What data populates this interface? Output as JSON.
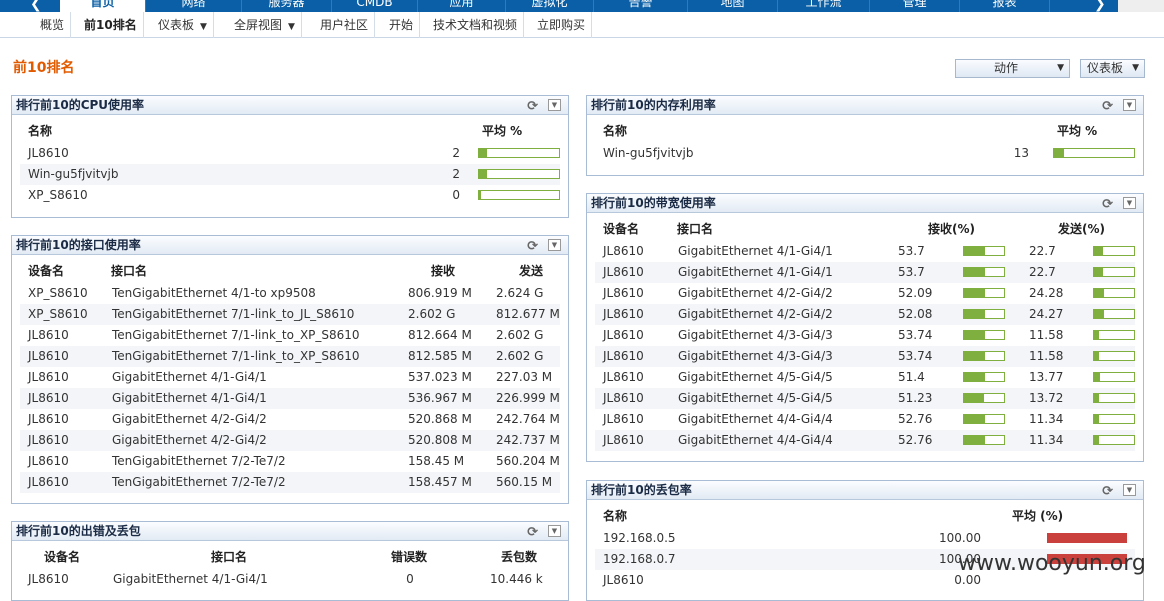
{
  "top_nav": {
    "tabs": [
      "首页",
      "网络",
      "服务器",
      "CMDB",
      "应用",
      "虚拟化",
      "告警",
      "地图",
      "工作流",
      "管理",
      "报表"
    ],
    "active": 0
  },
  "sub_nav": {
    "items": [
      {
        "label": "概览",
        "dropdown": false
      },
      {
        "label": "前10排名",
        "dropdown": false
      },
      {
        "label": "仪表板",
        "dropdown": true
      },
      {
        "label": "全屏视图",
        "dropdown": true
      },
      {
        "label": "用户社区",
        "dropdown": false
      },
      {
        "label": "开始",
        "dropdown": false
      },
      {
        "label": "技术文档和视频",
        "dropdown": false
      },
      {
        "label": "立即购买",
        "dropdown": false
      }
    ],
    "active": 1
  },
  "page_title": "前10排名",
  "actions": {
    "action_select": "动作",
    "dashboard_select": "仪表板"
  },
  "cpu": {
    "title": "排行前10的CPU使用率",
    "headers": [
      "名称",
      "平均 %"
    ],
    "rows": [
      {
        "name": "JL8610",
        "value": "2",
        "pct": 2
      },
      {
        "name": "Win-gu5fjvitvjb",
        "value": "2",
        "pct": 2
      },
      {
        "name": "XP_S8610",
        "value": "0",
        "pct": 0
      }
    ]
  },
  "memory": {
    "title": "排行前10的内存利用率",
    "headers": [
      "名称",
      "平均 %"
    ],
    "rows": [
      {
        "name": "Win-gu5fjvitvjb",
        "value": "13",
        "pct": 13
      }
    ]
  },
  "interface": {
    "title": "排行前10的接口使用率",
    "headers": [
      "设备名",
      "接口名",
      "接收",
      "发送"
    ],
    "rows": [
      [
        "XP_S8610",
        "TenGigabitEthernet 4/1-to xp9508",
        "806.919 M",
        "2.624 G"
      ],
      [
        "XP_S8610",
        "TenGigabitEthernet 7/1-link_to_JL_S8610",
        "2.602 G",
        "812.677 M"
      ],
      [
        "JL8610",
        "TenGigabitEthernet 7/1-link_to_XP_S8610",
        "812.664 M",
        "2.602 G"
      ],
      [
        "JL8610",
        "TenGigabitEthernet 7/1-link_to_XP_S8610",
        "812.585 M",
        "2.602 G"
      ],
      [
        "JL8610",
        "GigabitEthernet 4/1-Gi4/1",
        "537.023 M",
        "227.03 M"
      ],
      [
        "JL8610",
        "GigabitEthernet 4/1-Gi4/1",
        "536.967 M",
        "226.999 M"
      ],
      [
        "JL8610",
        "GigabitEthernet 4/2-Gi4/2",
        "520.868 M",
        "242.764 M"
      ],
      [
        "JL8610",
        "GigabitEthernet 4/2-Gi4/2",
        "520.808 M",
        "242.737 M"
      ],
      [
        "JL8610",
        "TenGigabitEthernet 7/2-Te7/2",
        "158.45 M",
        "560.204 M"
      ],
      [
        "JL8610",
        "TenGigabitEthernet 7/2-Te7/2",
        "158.457 M",
        "560.15 M"
      ]
    ]
  },
  "bandwidth": {
    "title": "排行前10的带宽使用率",
    "headers": [
      "设备名",
      "接口名",
      "接收(%)",
      "发送(%)"
    ],
    "rows": [
      {
        "device": "JL8610",
        "iface": "GigabitEthernet 4/1-Gi4/1",
        "rx": "53.7",
        "tx": "22.7"
      },
      {
        "device": "JL8610",
        "iface": "GigabitEthernet 4/1-Gi4/1",
        "rx": "53.7",
        "tx": "22.7"
      },
      {
        "device": "JL8610",
        "iface": "GigabitEthernet 4/2-Gi4/2",
        "rx": "52.09",
        "tx": "24.28"
      },
      {
        "device": "JL8610",
        "iface": "GigabitEthernet 4/2-Gi4/2",
        "rx": "52.08",
        "tx": "24.27"
      },
      {
        "device": "JL8610",
        "iface": "GigabitEthernet 4/3-Gi4/3",
        "rx": "53.74",
        "tx": "11.58"
      },
      {
        "device": "JL8610",
        "iface": "GigabitEthernet 4/3-Gi4/3",
        "rx": "53.74",
        "tx": "11.58"
      },
      {
        "device": "JL8610",
        "iface": "GigabitEthernet 4/5-Gi4/5",
        "rx": "51.4",
        "tx": "13.77"
      },
      {
        "device": "JL8610",
        "iface": "GigabitEthernet 4/5-Gi4/5",
        "rx": "51.23",
        "tx": "13.72"
      },
      {
        "device": "JL8610",
        "iface": "GigabitEthernet 4/4-Gi4/4",
        "rx": "52.76",
        "tx": "11.34"
      },
      {
        "device": "JL8610",
        "iface": "GigabitEthernet 4/4-Gi4/4",
        "rx": "52.76",
        "tx": "11.34"
      }
    ]
  },
  "errors": {
    "title": "排行前10的出错及丢包",
    "headers": [
      "设备名",
      "接口名",
      "错误数",
      "丢包数"
    ],
    "rows": [
      [
        "JL8610",
        "GigabitEthernet 4/1-Gi4/1",
        "0",
        "10.446 k"
      ]
    ]
  },
  "packet_loss": {
    "title": "排行前10的丢包率",
    "headers": [
      "名称",
      "平均 (%)"
    ],
    "rows": [
      {
        "name": "192.168.0.5",
        "value": "100.00",
        "pct": 100
      },
      {
        "name": "192.168.0.7",
        "value": "100.00",
        "pct": 100
      },
      {
        "name": "JL8610",
        "value": "0.00",
        "pct": 0
      }
    ]
  },
  "watermark": "www.wooyun.org",
  "colors": {
    "accent": "#e15a00",
    "nav": "#0a5fa6",
    "bar_green": "#7fb03f",
    "bar_red": "#c9403d"
  }
}
